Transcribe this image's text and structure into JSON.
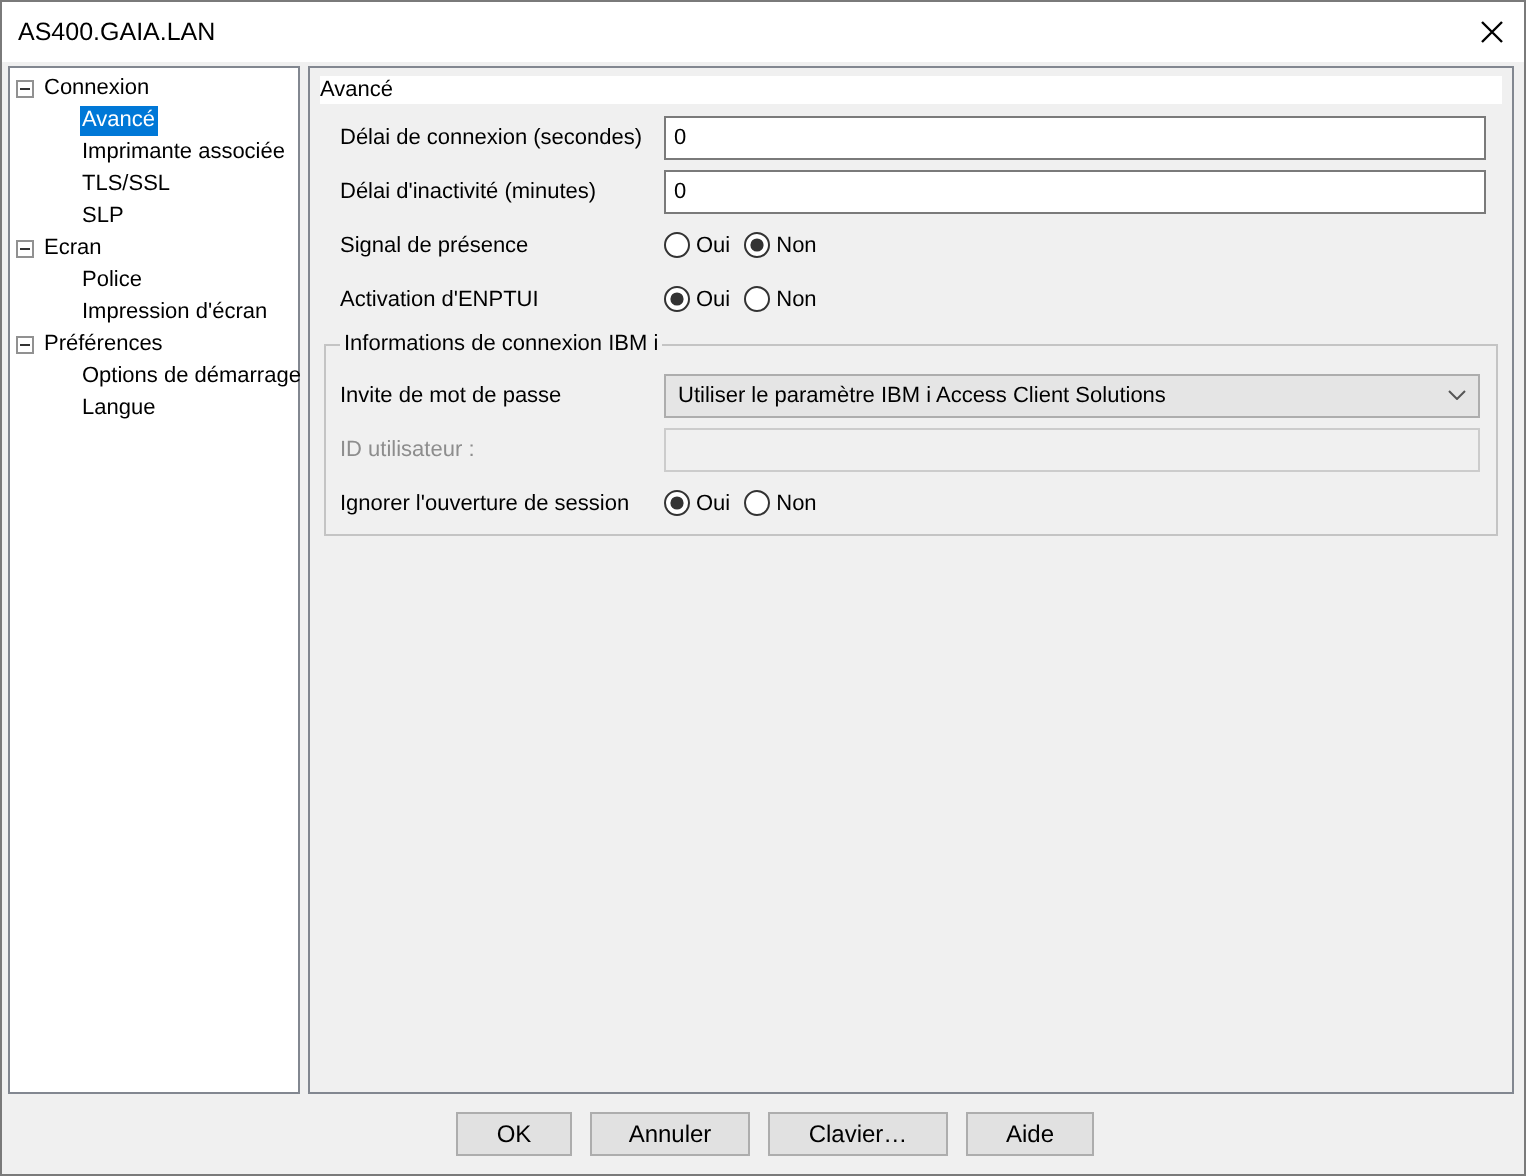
{
  "window": {
    "title": "AS400.GAIA.LAN"
  },
  "tree": [
    {
      "label": "Connexion",
      "expanded": true,
      "selected": false,
      "children": [
        {
          "label": "Avancé",
          "selected": true
        },
        {
          "label": "Imprimante associée",
          "selected": false
        },
        {
          "label": "TLS/SSL",
          "selected": false
        },
        {
          "label": "SLP",
          "selected": false
        }
      ]
    },
    {
      "label": "Ecran",
      "expanded": true,
      "selected": false,
      "children": [
        {
          "label": "Police",
          "selected": false
        },
        {
          "label": "Impression d'écran",
          "selected": false
        }
      ]
    },
    {
      "label": "Préférences",
      "expanded": true,
      "selected": false,
      "children": [
        {
          "label": "Options de démarrage",
          "selected": false
        },
        {
          "label": "Langue",
          "selected": false
        }
      ]
    }
  ],
  "panel": {
    "header": "Avancé",
    "rows": [
      {
        "kind": "field",
        "label": "Délai de connexion (secondes)",
        "value": "0",
        "disabled": false
      },
      {
        "kind": "field",
        "label": "Délai d'inactivité (minutes)",
        "value": "0",
        "disabled": false
      },
      {
        "kind": "radio",
        "label": "Signal de présence",
        "options": [
          {
            "label": "Oui",
            "selected": false
          },
          {
            "label": "Non",
            "selected": true
          }
        ]
      },
      {
        "kind": "radio",
        "label": "Activation d'ENPTUI",
        "options": [
          {
            "label": "Oui",
            "selected": true
          },
          {
            "label": "Non",
            "selected": false
          }
        ]
      }
    ],
    "group": {
      "legend": "Informations de connexion IBM i",
      "rows": [
        {
          "kind": "dropdown",
          "label": "Invite de mot de passe",
          "value": "Utiliser le paramètre IBM i Access Client Solutions"
        },
        {
          "kind": "field",
          "label": "ID utilisateur :",
          "disabled": true
        },
        {
          "kind": "radio",
          "label": "Ignorer l'ouverture de session",
          "options": [
            {
              "label": "Oui",
              "selected": true
            },
            {
              "label": "Non",
              "selected": false
            }
          ]
        }
      ]
    }
  },
  "buttons": [
    "OK",
    "Annuler",
    "Clavier…",
    "Aide"
  ]
}
